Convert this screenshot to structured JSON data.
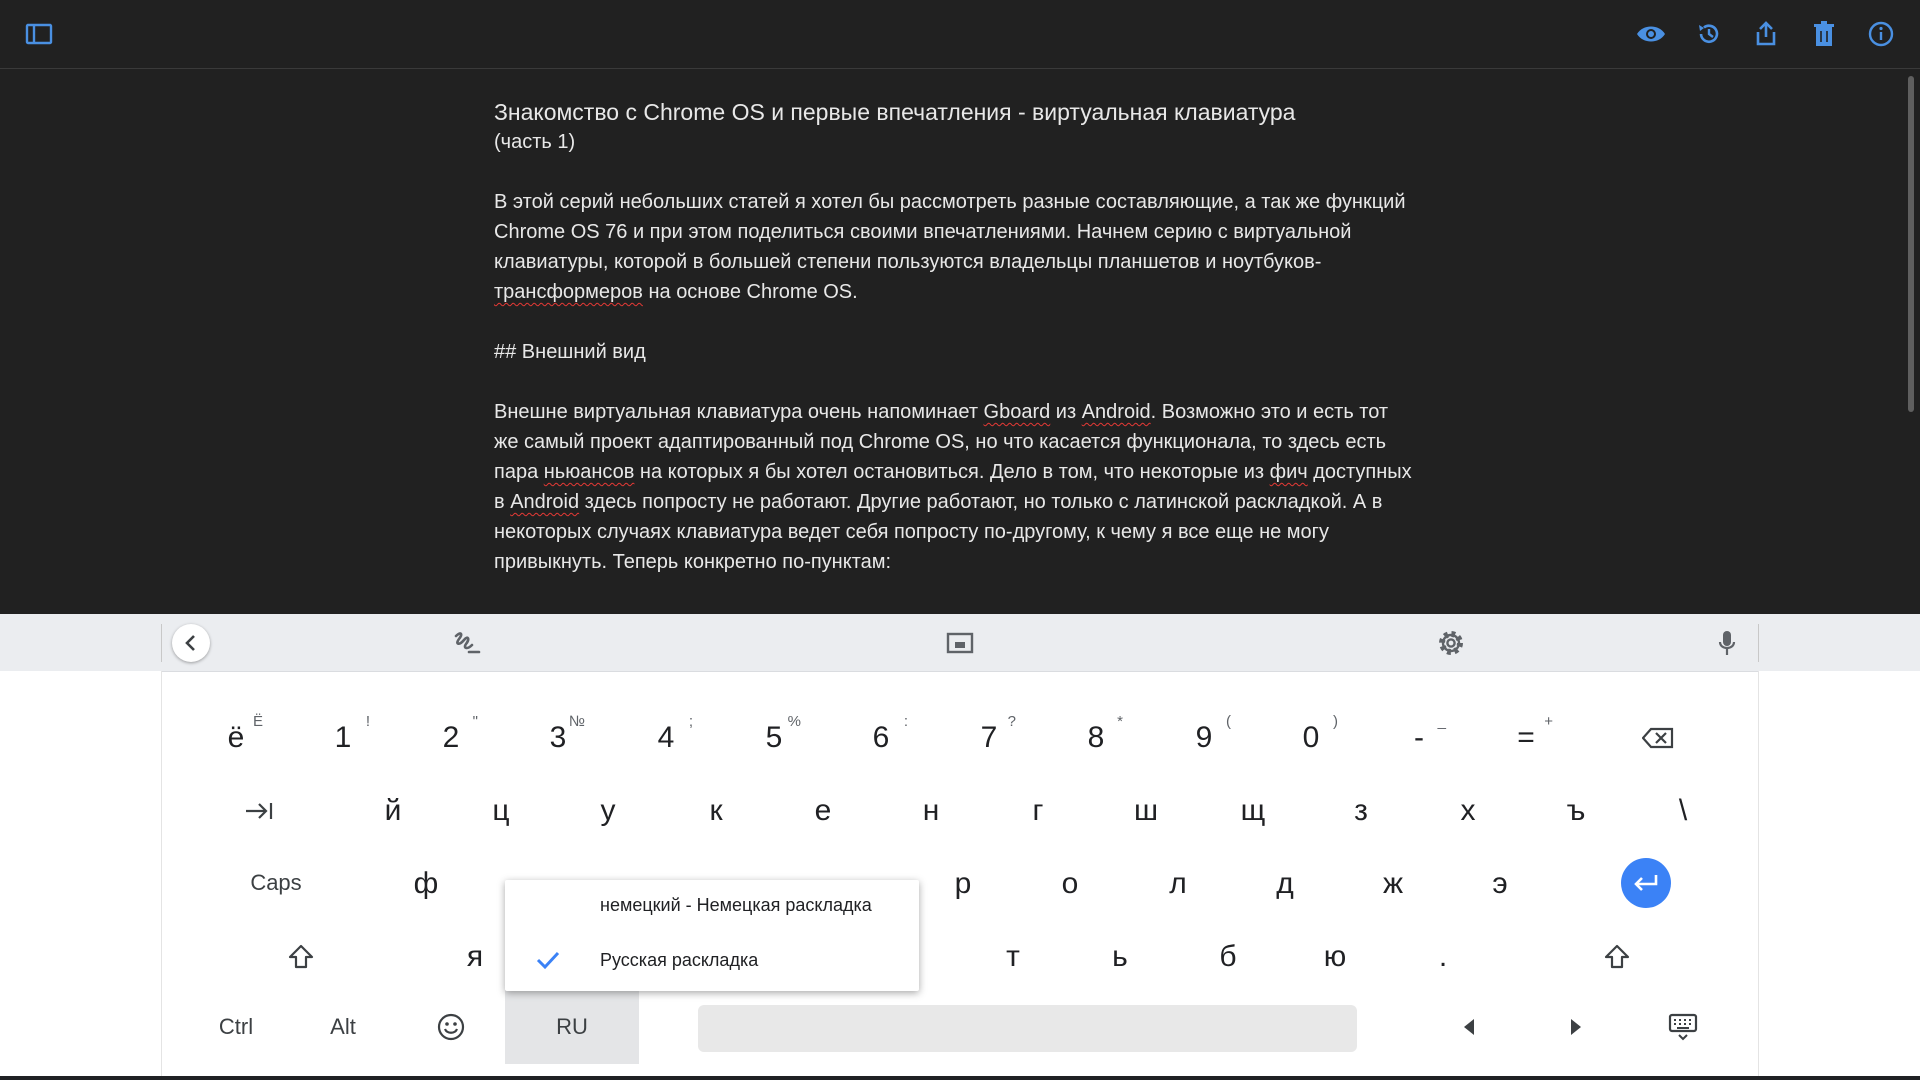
{
  "toolbar": {
    "sidebar_icon": "sidebar-toggle-icon",
    "right_icons": [
      "eye-icon",
      "history-icon",
      "share-icon",
      "trash-icon",
      "info-icon"
    ],
    "accent": "#4a90e2"
  },
  "doc": {
    "title": "Знакомство с Chrome OS и первые впечатления - виртуальная клавиатура",
    "subtitle": "(часть 1)",
    "p1": {
      "a": "В этой серий небольших статей я хотел бы рассмотреть разные составляющие, а так же функций Chrome OS 76 и при этом поделиться своими впечатлениями. Начнем серию с виртуальной клавиатуры, которой в большей степени пользуются владельцы планшетов и ноутбуков-",
      "b": "трансформеров",
      "c": " на основе Chrome OS."
    },
    "heading": "## Внешний вид",
    "p2": {
      "a": "Внешне виртуальная клавиатура очень напоминает ",
      "b": "Gboard",
      "c": " из ",
      "d": "Android",
      "e": ". Возможно это и есть тот же самый проект адаптированный под Chrome OS, но что касается функционала, то здесь есть пара ",
      "f": "ньюансов",
      "g": " на которых я бы хотел остановиться. Дело в том, что некоторые из ",
      "h": "фич",
      "i": " доступных в ",
      "j": "Android",
      "k": " здесь попросту не работают. Другие работают, но только с латинской раскладкой. А в некоторых случаях клавиатура ведет себя попросту по-другому, к чему я все еще не могу привыкнуть. Теперь конкретно по-пунктам:"
    }
  },
  "keyboard": {
    "top_icons": [
      "back-icon",
      "handwriting-icon",
      "floating-keyboard-icon",
      "settings-icon",
      "microphone-icon"
    ],
    "row1": [
      {
        "k": "ё",
        "s": "Ё"
      },
      {
        "k": "1",
        "s": "!"
      },
      {
        "k": "2",
        "s": "\""
      },
      {
        "k": "3",
        "s": "№"
      },
      {
        "k": "4",
        "s": ";"
      },
      {
        "k": "5",
        "s": "%"
      },
      {
        "k": "6",
        "s": ":"
      },
      {
        "k": "7",
        "s": "?"
      },
      {
        "k": "8",
        "s": "*"
      },
      {
        "k": "9",
        "s": "("
      },
      {
        "k": "0",
        "s": ")"
      },
      {
        "k": "-",
        "s": "_"
      },
      {
        "k": "=",
        "s": "+"
      }
    ],
    "row2": [
      "й",
      "ц",
      "у",
      "к",
      "е",
      "н",
      "г",
      "ш",
      "щ",
      "з",
      "х",
      "ъ",
      "\\"
    ],
    "row3_left": [
      "ф"
    ],
    "row3_right": [
      "р",
      "о",
      "л",
      "д",
      "ж",
      "э"
    ],
    "row4_left": [
      "я"
    ],
    "row4_right": [
      "т",
      "ь",
      "б",
      "ю",
      "."
    ],
    "caps": "Caps",
    "ctrl": "Ctrl",
    "alt": "Alt",
    "lang": "RU"
  },
  "lang_menu": {
    "items": [
      "немецкий - Немецкая раскладка",
      "Русская раскладка"
    ],
    "selected": "Русская раскладка"
  }
}
